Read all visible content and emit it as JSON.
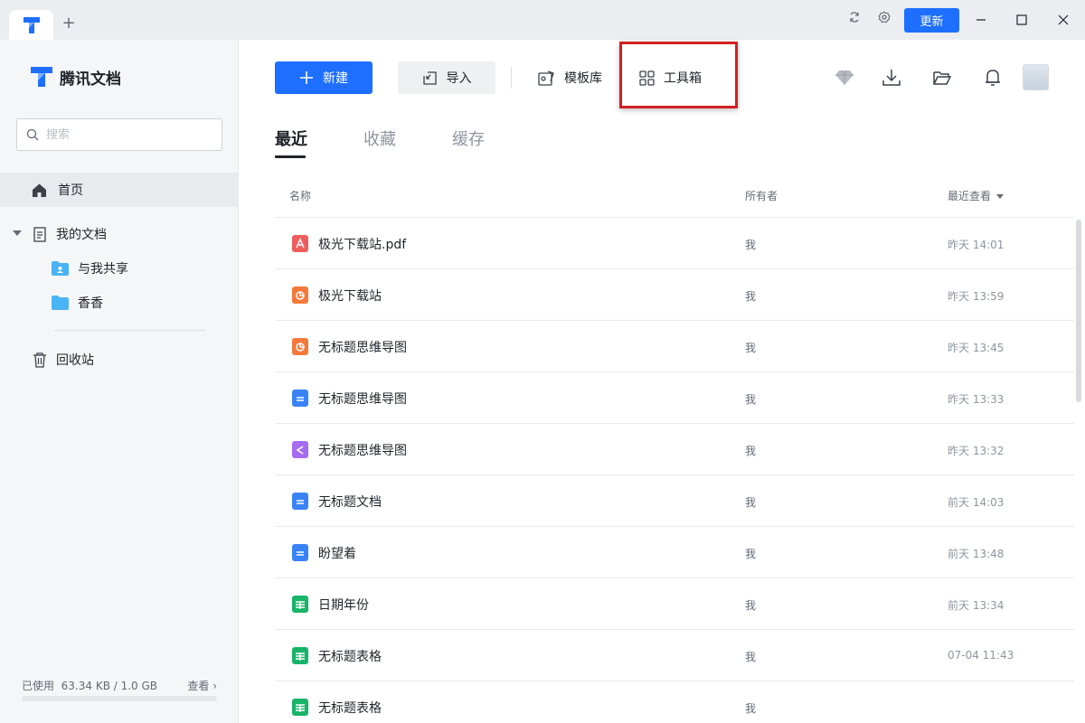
{
  "titlebar": {
    "update_label": "更新",
    "new_tab_symbol": "+"
  },
  "sidebar": {
    "brand": "腾讯文档",
    "search_placeholder": "搜索",
    "home": "首页",
    "my_docs": "我的文档",
    "shared": "与我共享",
    "folder": "香香",
    "trash": "回收站",
    "storage_label": "已使用",
    "storage_value": "63.34 KB / 1.0 GB",
    "storage_view": "查看 ›",
    "storage_fraction": 0.0001
  },
  "toolbar": {
    "new": "新建",
    "import": "导入",
    "templates": "模板库",
    "toolbox": "工具箱"
  },
  "tabs": [
    "最近",
    "收藏",
    "缓存"
  ],
  "table": {
    "col_name": "名称",
    "col_owner": "所有者",
    "col_time": "最近查看",
    "rows": [
      {
        "name": "极光下载站.pdf",
        "owner": "我",
        "time": "昨天 14:01",
        "type": "pdf"
      },
      {
        "name": "极光下载站",
        "owner": "我",
        "time": "昨天 13:59",
        "type": "slide"
      },
      {
        "name": "无标题思维导图",
        "owner": "我",
        "time": "昨天 13:45",
        "type": "slide"
      },
      {
        "name": "无标题思维导图",
        "owner": "我",
        "time": "昨天 13:33",
        "type": "doc"
      },
      {
        "name": "无标题思维导图",
        "owner": "我",
        "time": "昨天 13:32",
        "type": "mind"
      },
      {
        "name": "无标题文档",
        "owner": "我",
        "time": "前天 14:03",
        "type": "doc"
      },
      {
        "name": "盼望着",
        "owner": "我",
        "time": "前天 13:48",
        "type": "doc"
      },
      {
        "name": "日期年份",
        "owner": "我",
        "time": "前天 13:34",
        "type": "sheet"
      },
      {
        "name": "无标题表格",
        "owner": "我",
        "time": "07-04 11:43",
        "type": "sheet"
      },
      {
        "name": "无标题表格",
        "owner": "我",
        "time": "",
        "type": "sheet"
      }
    ]
  },
  "colors": {
    "accent": "#1e6fff",
    "pdf": "#f05d5d",
    "slide": "#f5793a",
    "doc": "#3a83f7",
    "mind": "#a66cf1",
    "sheet": "#18b468",
    "highlight": "#d32020"
  }
}
